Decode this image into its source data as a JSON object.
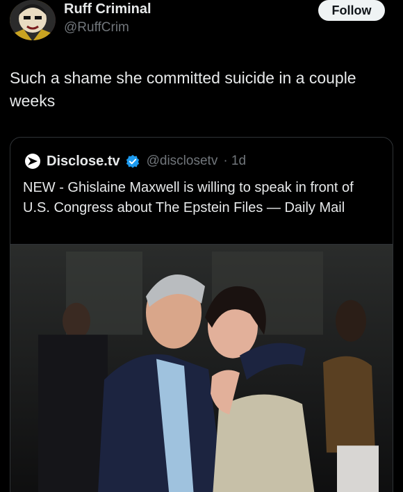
{
  "author": {
    "display_name": "Ruff Criminal",
    "handle": "@RuffCrim",
    "avatar_icon": "profile-avatar"
  },
  "follow_label": "Follow",
  "tweet": {
    "text": "Such a shame she committed suicide in a couple weeks"
  },
  "quoted": {
    "name": "Disclose.tv",
    "handle": "@disclosetv",
    "time": "· 1d",
    "text": "NEW - Ghislaine Maxwell is willing to speak in front of U.S. Congress about The Epstein Files — Daily Mail",
    "logo_icon": "disclose-logo-icon",
    "verified_icon": "verified-badge-icon",
    "photo": "party-photo-of-two-people"
  },
  "colors": {
    "background": "#000000",
    "text": "#e7e9ea",
    "muted": "#71767b",
    "verified": "#1d9bf0",
    "border": "#2f3336"
  }
}
